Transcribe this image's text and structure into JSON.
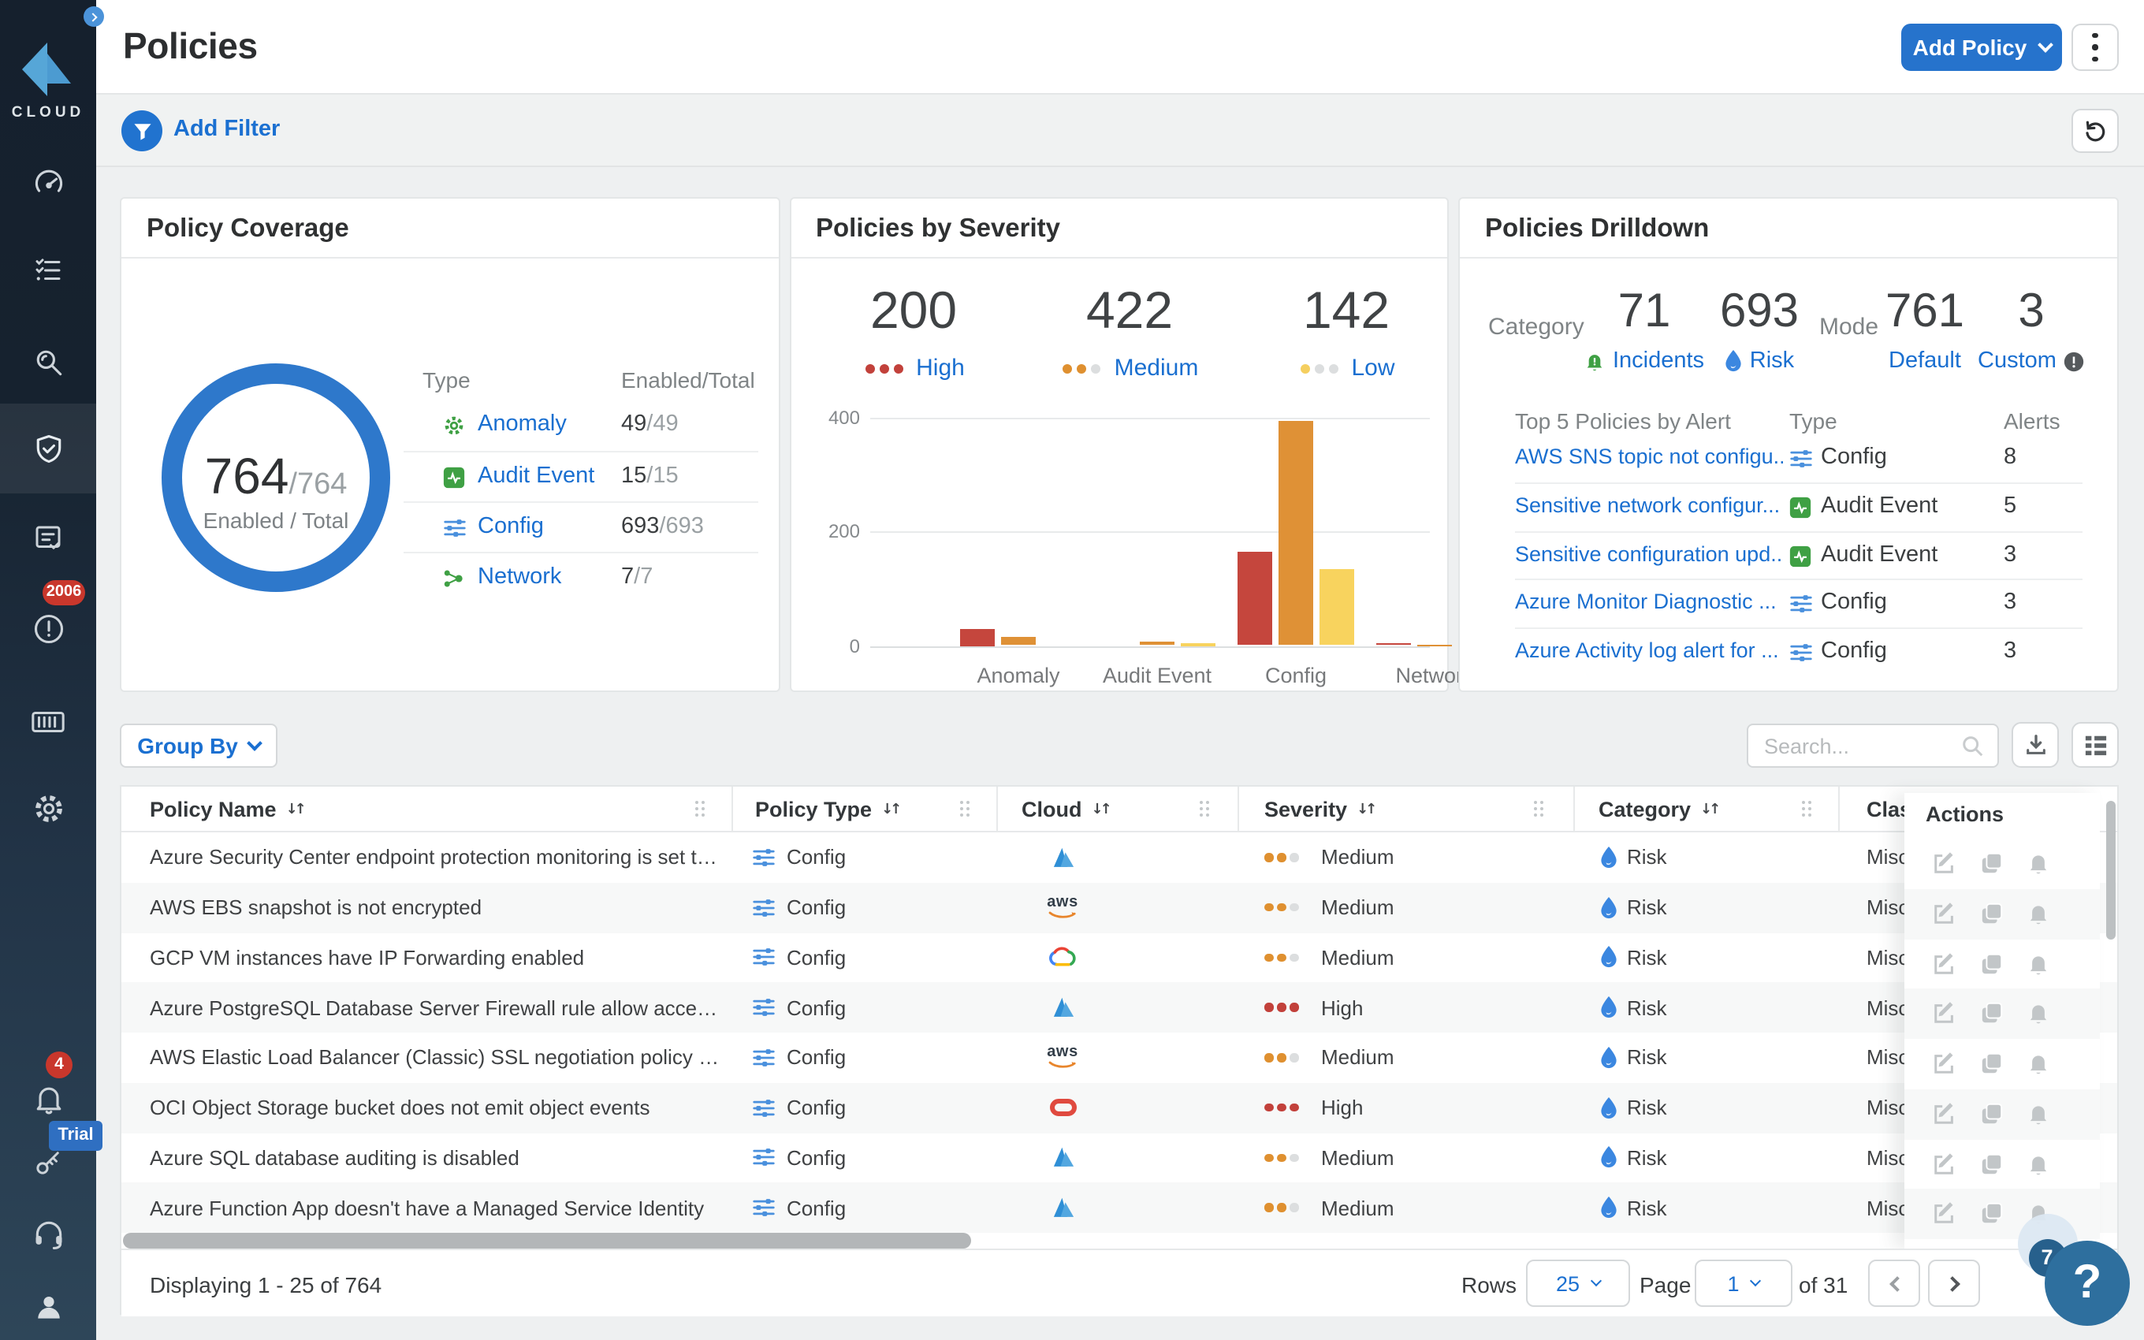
{
  "sidebar": {
    "logo_text": "CLOUD",
    "compliance_badge": "2006",
    "notification_badge": "4",
    "trial_badge": "Trial",
    "items": [
      "collapse",
      "dashboard",
      "inventory",
      "investigate",
      "policies",
      "compliance",
      "alerts",
      "compute",
      "settings",
      "notifications",
      "trial-key",
      "support",
      "account"
    ]
  },
  "header": {
    "title": "Policies",
    "add_policy_label": "Add Policy"
  },
  "filter_bar": {
    "add_filter_label": "Add Filter"
  },
  "cards": {
    "coverage": {
      "title": "Policy Coverage",
      "donut": {
        "enabled": "764",
        "total": "/764",
        "caption": "Enabled / Total",
        "ring_color": "#2e78cb"
      },
      "table": {
        "type_header": "Type",
        "enabled_header": "Enabled/Total",
        "rows": [
          {
            "type": "Anomaly",
            "icon": "anomaly",
            "enabled": "49",
            "total": "/49"
          },
          {
            "type": "Audit Event",
            "icon": "audit",
            "enabled": "15",
            "total": "/15"
          },
          {
            "type": "Config",
            "icon": "config",
            "enabled": "693",
            "total": "/693"
          },
          {
            "type": "Network",
            "icon": "network",
            "enabled": "7",
            "total": "/7"
          }
        ]
      }
    },
    "severity": {
      "title": "Policies by Severity",
      "stats": [
        {
          "value": "200",
          "label": "High",
          "dots": [
            "#c2413b",
            "#c2413b",
            "#c2413b"
          ]
        },
        {
          "value": "422",
          "label": "Medium",
          "dots": [
            "#df9030",
            "#df9030",
            "#dcdedf"
          ]
        },
        {
          "value": "142",
          "label": "Low",
          "dots": [
            "#f5cf5f",
            "#dcdedf",
            "#dcdedf"
          ]
        }
      ],
      "chart_data": {
        "type": "bar",
        "categories": [
          "Anomaly",
          "Audit Event",
          "Config",
          "Network"
        ],
        "series": [
          {
            "name": "High",
            "color": "#c5463d",
            "values": [
              30,
              0,
              163,
              4
            ]
          },
          {
            "name": "Medium",
            "color": "#df9136",
            "values": [
              16,
              8,
              394,
              2
            ]
          },
          {
            "name": "Low",
            "color": "#f8d35e",
            "values": [
              0,
              5,
              134,
              0
            ]
          }
        ],
        "ylim": [
          0,
          400
        ],
        "yticks": [
          "0",
          "200",
          "400"
        ]
      }
    },
    "drilldown": {
      "title": "Policies Drilldown",
      "category_label": "Category",
      "mode_label": "Mode",
      "category_stats": [
        {
          "value": "71",
          "label": "Incidents",
          "icon": "incident-bell"
        },
        {
          "value": "693",
          "label": "Risk",
          "icon": "risk-flame"
        }
      ],
      "mode_stats": [
        {
          "value": "761",
          "label": "Default",
          "icon": ""
        },
        {
          "value": "3",
          "label": "Custom",
          "icon": "info"
        }
      ],
      "table": {
        "col1": "Top 5 Policies by Alert",
        "col2": "Type",
        "col3": "Alerts",
        "rows": [
          {
            "policy": "AWS SNS topic not configu...",
            "type": "Config",
            "icon": "config",
            "alerts": "8"
          },
          {
            "policy": "Sensitive network configur...",
            "type": "Audit Event",
            "icon": "audit",
            "alerts": "5"
          },
          {
            "policy": "Sensitive configuration upd...",
            "type": "Audit Event",
            "icon": "audit",
            "alerts": "3"
          },
          {
            "policy": "Azure Monitor Diagnostic ...",
            "type": "Config",
            "icon": "config",
            "alerts": "3"
          },
          {
            "policy": "Azure Activity log alert for ...",
            "type": "Config",
            "icon": "config",
            "alerts": "3"
          }
        ]
      }
    }
  },
  "toolbar": {
    "group_by_label": "Group By",
    "search_placeholder": "Search..."
  },
  "table": {
    "columns": [
      "Policy Name",
      "Policy Type",
      "Cloud",
      "Severity",
      "Category",
      "Class",
      "Actions"
    ],
    "rows": [
      {
        "name": "Azure Security Center endpoint protection monitoring is set to disab...",
        "type": "Config",
        "cloud": "azure",
        "severity": "Medium",
        "category": "Risk",
        "class": "Misc"
      },
      {
        "name": "AWS EBS snapshot is not encrypted",
        "type": "Config",
        "cloud": "aws",
        "severity": "Medium",
        "category": "Risk",
        "class": "Misc"
      },
      {
        "name": "GCP VM instances have IP Forwarding enabled",
        "type": "Config",
        "cloud": "gcp",
        "severity": "Medium",
        "category": "Risk",
        "class": "Misc"
      },
      {
        "name": "Azure PostgreSQL Database Server Firewall rule allow access to all I...",
        "type": "Config",
        "cloud": "azure",
        "severity": "High",
        "category": "Risk",
        "class": "Misc"
      },
      {
        "name": "AWS Elastic Load Balancer (Classic) SSL negotiation policy configure...",
        "type": "Config",
        "cloud": "aws",
        "severity": "Medium",
        "category": "Risk",
        "class": "Misc"
      },
      {
        "name": "OCI Object Storage bucket does not emit object events",
        "type": "Config",
        "cloud": "oci",
        "severity": "High",
        "category": "Risk",
        "class": "Misc"
      },
      {
        "name": "Azure SQL database auditing is disabled",
        "type": "Config",
        "cloud": "azure",
        "severity": "Medium",
        "category": "Risk",
        "class": "Misc"
      },
      {
        "name": "Azure Function App doesn't have a Managed Service Identity",
        "type": "Config",
        "cloud": "azure",
        "severity": "Medium",
        "category": "Risk",
        "class": "Misc"
      }
    ]
  },
  "footer": {
    "displaying": "Displaying 1 - 25 of 764",
    "rows_label": "Rows",
    "rows_value": "25",
    "page_label": "Page",
    "page_value": "1",
    "of_label": "of 31"
  },
  "help": {
    "badge": "7",
    "label": "?"
  }
}
